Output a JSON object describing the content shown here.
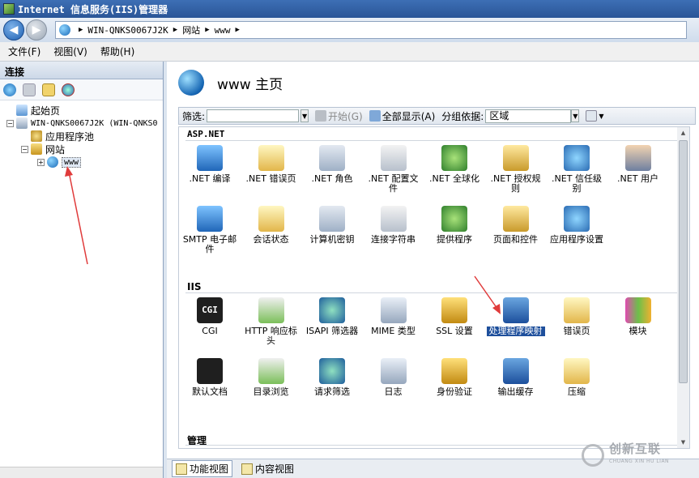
{
  "window": {
    "title": "Internet 信息服务(IIS)管理器"
  },
  "address": {
    "segments": [
      "WIN-QNKS0067J2K",
      "网站",
      "www"
    ],
    "trailing_sep": "▶"
  },
  "menu": {
    "items": [
      "文件(F)",
      "视图(V)",
      "帮助(H)"
    ]
  },
  "connections": {
    "header": "连接",
    "tree": [
      {
        "label": "起始页",
        "level": 1,
        "expander": ""
      },
      {
        "label": "WIN-QNKS0067J2K (WIN-QNKS0",
        "level": 0,
        "expander": "−"
      },
      {
        "label": "应用程序池",
        "level": 2,
        "expander": ""
      },
      {
        "label": "网站",
        "level": 1,
        "expander": "−"
      },
      {
        "label": "www",
        "level": 2,
        "expander": "+"
      }
    ]
  },
  "main": {
    "title": "www 主页",
    "filter": {
      "label": "筛选:",
      "start_label": "开始(G)",
      "show_all_label": "全部显示(A)",
      "group_label": "分组依据:",
      "group_value": "区域"
    },
    "sections": {
      "aspnet": "ASP.NET",
      "iis": "IIS",
      "manage": "管理"
    },
    "aspnet_features": [
      ".NET 编译",
      ".NET 错误页",
      ".NET 角色",
      ".NET 配置文件",
      ".NET 全球化",
      ".NET 授权规则",
      ".NET 信任级别",
      ".NET 用户",
      "SMTP 电子邮件",
      "会话状态",
      "计算机密钥",
      "连接字符串",
      "提供程序",
      "页面和控件",
      "应用程序设置"
    ],
    "iis_features": [
      "CGI",
      "HTTP 响应标头",
      "ISAPI 筛选器",
      "MIME 类型",
      "SSL 设置",
      "处理程序映射",
      "错误页",
      "模块",
      "默认文档",
      "目录浏览",
      "请求筛选",
      "日志",
      "身份验证",
      "输出缓存",
      "压缩"
    ],
    "selected_feature": "处理程序映射"
  },
  "bottom_tabs": [
    "功能视图",
    "内容视图"
  ],
  "watermark": {
    "title": "创新互联",
    "subtitle": "CHUANG XIN HU LIAN"
  },
  "colors": {
    "title_bar": "#2a5597",
    "selection": "#1e4f9c",
    "annotation_arrow": "#e03b3b"
  }
}
